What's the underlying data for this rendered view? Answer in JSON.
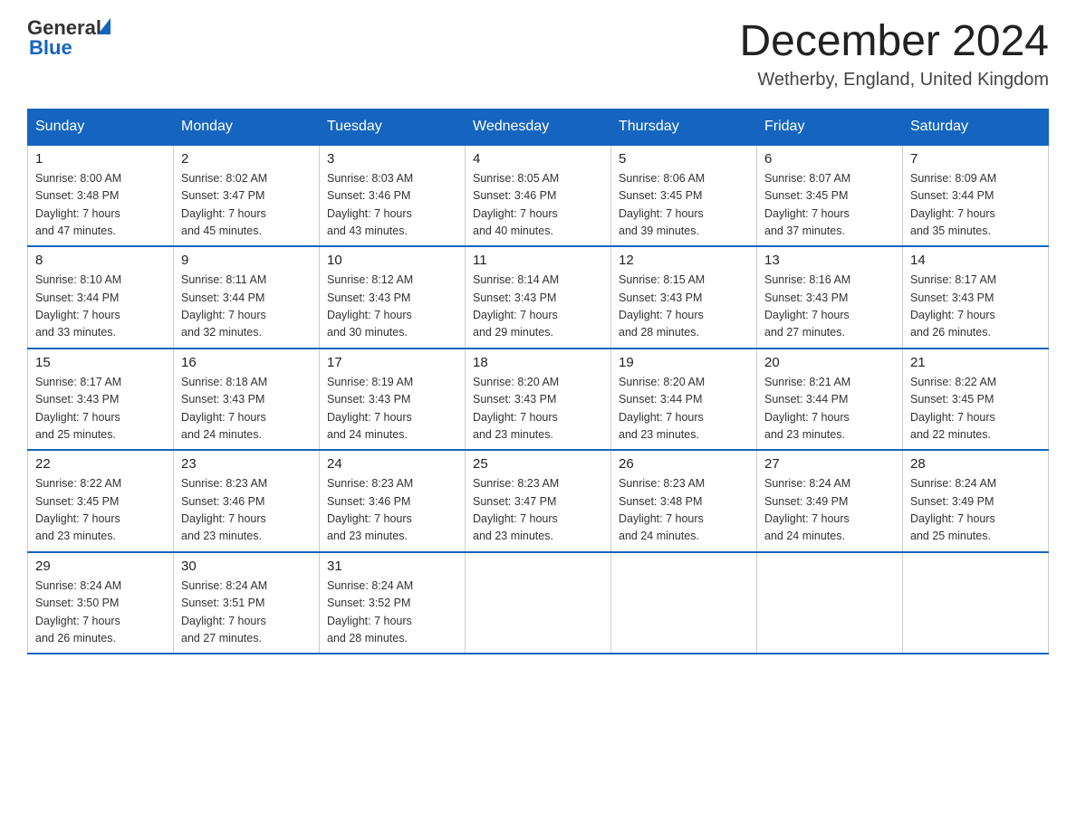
{
  "logo": {
    "general": "General",
    "blue": "Blue"
  },
  "title": "December 2024",
  "location": "Wetherby, England, United Kingdom",
  "days_of_week": [
    "Sunday",
    "Monday",
    "Tuesday",
    "Wednesday",
    "Thursday",
    "Friday",
    "Saturday"
  ],
  "weeks": [
    [
      {
        "day": "1",
        "sunrise": "8:00 AM",
        "sunset": "3:48 PM",
        "daylight": "7 hours and 47 minutes."
      },
      {
        "day": "2",
        "sunrise": "8:02 AM",
        "sunset": "3:47 PM",
        "daylight": "7 hours and 45 minutes."
      },
      {
        "day": "3",
        "sunrise": "8:03 AM",
        "sunset": "3:46 PM",
        "daylight": "7 hours and 43 minutes."
      },
      {
        "day": "4",
        "sunrise": "8:05 AM",
        "sunset": "3:46 PM",
        "daylight": "7 hours and 40 minutes."
      },
      {
        "day": "5",
        "sunrise": "8:06 AM",
        "sunset": "3:45 PM",
        "daylight": "7 hours and 39 minutes."
      },
      {
        "day": "6",
        "sunrise": "8:07 AM",
        "sunset": "3:45 PM",
        "daylight": "7 hours and 37 minutes."
      },
      {
        "day": "7",
        "sunrise": "8:09 AM",
        "sunset": "3:44 PM",
        "daylight": "7 hours and 35 minutes."
      }
    ],
    [
      {
        "day": "8",
        "sunrise": "8:10 AM",
        "sunset": "3:44 PM",
        "daylight": "7 hours and 33 minutes."
      },
      {
        "day": "9",
        "sunrise": "8:11 AM",
        "sunset": "3:44 PM",
        "daylight": "7 hours and 32 minutes."
      },
      {
        "day": "10",
        "sunrise": "8:12 AM",
        "sunset": "3:43 PM",
        "daylight": "7 hours and 30 minutes."
      },
      {
        "day": "11",
        "sunrise": "8:14 AM",
        "sunset": "3:43 PM",
        "daylight": "7 hours and 29 minutes."
      },
      {
        "day": "12",
        "sunrise": "8:15 AM",
        "sunset": "3:43 PM",
        "daylight": "7 hours and 28 minutes."
      },
      {
        "day": "13",
        "sunrise": "8:16 AM",
        "sunset": "3:43 PM",
        "daylight": "7 hours and 27 minutes."
      },
      {
        "day": "14",
        "sunrise": "8:17 AM",
        "sunset": "3:43 PM",
        "daylight": "7 hours and 26 minutes."
      }
    ],
    [
      {
        "day": "15",
        "sunrise": "8:17 AM",
        "sunset": "3:43 PM",
        "daylight": "7 hours and 25 minutes."
      },
      {
        "day": "16",
        "sunrise": "8:18 AM",
        "sunset": "3:43 PM",
        "daylight": "7 hours and 24 minutes."
      },
      {
        "day": "17",
        "sunrise": "8:19 AM",
        "sunset": "3:43 PM",
        "daylight": "7 hours and 24 minutes."
      },
      {
        "day": "18",
        "sunrise": "8:20 AM",
        "sunset": "3:43 PM",
        "daylight": "7 hours and 23 minutes."
      },
      {
        "day": "19",
        "sunrise": "8:20 AM",
        "sunset": "3:44 PM",
        "daylight": "7 hours and 23 minutes."
      },
      {
        "day": "20",
        "sunrise": "8:21 AM",
        "sunset": "3:44 PM",
        "daylight": "7 hours and 23 minutes."
      },
      {
        "day": "21",
        "sunrise": "8:22 AM",
        "sunset": "3:45 PM",
        "daylight": "7 hours and 22 minutes."
      }
    ],
    [
      {
        "day": "22",
        "sunrise": "8:22 AM",
        "sunset": "3:45 PM",
        "daylight": "7 hours and 23 minutes."
      },
      {
        "day": "23",
        "sunrise": "8:23 AM",
        "sunset": "3:46 PM",
        "daylight": "7 hours and 23 minutes."
      },
      {
        "day": "24",
        "sunrise": "8:23 AM",
        "sunset": "3:46 PM",
        "daylight": "7 hours and 23 minutes."
      },
      {
        "day": "25",
        "sunrise": "8:23 AM",
        "sunset": "3:47 PM",
        "daylight": "7 hours and 23 minutes."
      },
      {
        "day": "26",
        "sunrise": "8:23 AM",
        "sunset": "3:48 PM",
        "daylight": "7 hours and 24 minutes."
      },
      {
        "day": "27",
        "sunrise": "8:24 AM",
        "sunset": "3:49 PM",
        "daylight": "7 hours and 24 minutes."
      },
      {
        "day": "28",
        "sunrise": "8:24 AM",
        "sunset": "3:49 PM",
        "daylight": "7 hours and 25 minutes."
      }
    ],
    [
      {
        "day": "29",
        "sunrise": "8:24 AM",
        "sunset": "3:50 PM",
        "daylight": "7 hours and 26 minutes."
      },
      {
        "day": "30",
        "sunrise": "8:24 AM",
        "sunset": "3:51 PM",
        "daylight": "7 hours and 27 minutes."
      },
      {
        "day": "31",
        "sunrise": "8:24 AM",
        "sunset": "3:52 PM",
        "daylight": "7 hours and 28 minutes."
      },
      null,
      null,
      null,
      null
    ]
  ]
}
